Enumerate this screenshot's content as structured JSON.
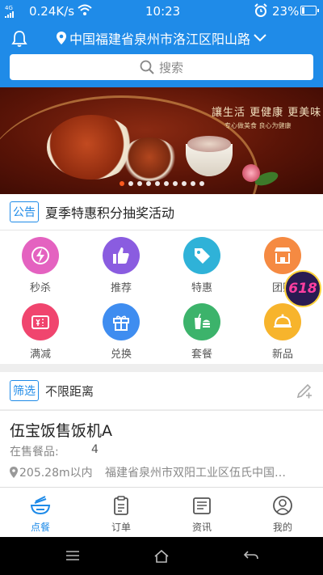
{
  "status_bar": {
    "signal": "4G",
    "net_speed": "0.24K/s",
    "time": "10:23",
    "battery": "23%",
    "battery_level": 0.23
  },
  "header": {
    "location": "中国福建省泉州市洛江区阳山路",
    "search_placeholder": "搜索"
  },
  "banner": {
    "slogan": "讓生活 更健康 更美味",
    "sub_slogan": "专心做美食 良心为健康",
    "dot_count": 10,
    "active_dot": 0
  },
  "notice": {
    "tag": "公告",
    "text": "夏季特惠积分抽奖活动"
  },
  "categories": [
    {
      "label": "秒杀",
      "color": "#e462c0",
      "icon": "flash-icon"
    },
    {
      "label": "推荐",
      "color": "#8a5ce0",
      "icon": "thumbs-up-icon"
    },
    {
      "label": "特惠",
      "color": "#2fb2d8",
      "icon": "price-tag-icon"
    },
    {
      "label": "团购",
      "color": "#f58a42",
      "icon": "store-icon"
    },
    {
      "label": "满减",
      "color": "#f0456e",
      "icon": "coupon-icon"
    },
    {
      "label": "兑换",
      "color": "#3f8df0",
      "icon": "gift-icon"
    },
    {
      "label": "套餐",
      "color": "#3cb36b",
      "icon": "meal-set-icon"
    },
    {
      "label": "新品",
      "color": "#f7b42c",
      "icon": "cloche-icon"
    }
  ],
  "promo_badge": "618",
  "filter": {
    "tag": "筛选",
    "text": "不限距离"
  },
  "store": {
    "name": "伍宝饭售饭机A",
    "count_label": "在售餐品:",
    "count": "4",
    "distance": "205.28m以内",
    "address": "福建省泉州市双阳工业区伍氏中国…"
  },
  "tabs": [
    {
      "label": "点餐",
      "icon": "bowl-icon",
      "active": true
    },
    {
      "label": "订单",
      "icon": "clipboard-icon",
      "active": false
    },
    {
      "label": "资讯",
      "icon": "news-icon",
      "active": false
    },
    {
      "label": "我的",
      "icon": "user-icon",
      "active": false
    }
  ],
  "colors": {
    "primary": "#1f8be8",
    "active_dot": "#ff5a1f"
  }
}
